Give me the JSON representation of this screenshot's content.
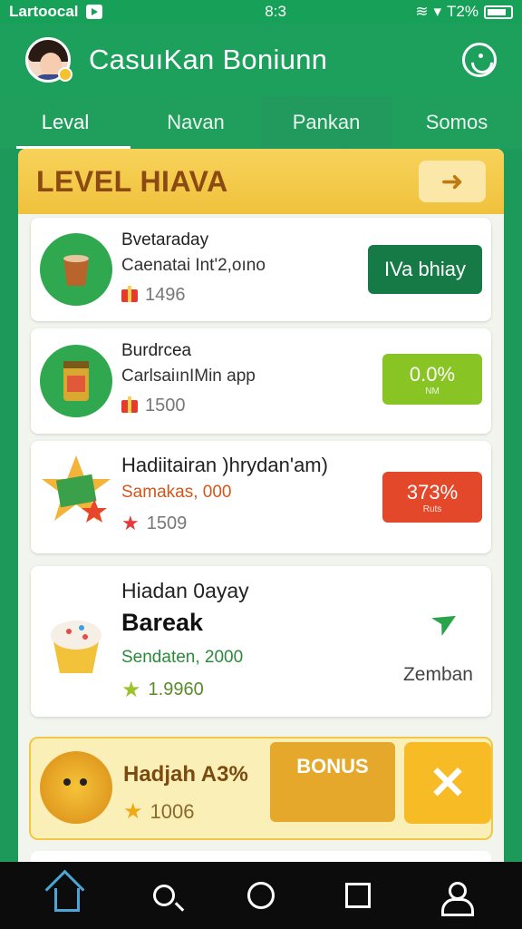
{
  "status_bar": {
    "carrier": "Lartoocal",
    "time": "8:3",
    "battery": "T2%"
  },
  "header": {
    "title": "CasuıKan Boniunn"
  },
  "tabs": [
    {
      "label": "Leval"
    },
    {
      "label": "Navan"
    },
    {
      "label": "Pankan"
    },
    {
      "label": "Somos"
    }
  ],
  "level_banner": {
    "title": "LEVEL HIAVA",
    "arrow": "➜"
  },
  "cards": [
    {
      "title": "Bvetaraday",
      "subtitle": "Caenatai Int'2,oıno",
      "stat": "1496",
      "action_main": "IVa bhiay",
      "action_small": ""
    },
    {
      "title": "Burdrcea",
      "subtitle": "CarlsaiınIMin app",
      "stat": "1500",
      "action_main": "0.0%",
      "action_small": "NM"
    },
    {
      "title": "Hadiitairan )hrydan'am)",
      "subtitle": "Samakas, 000",
      "stat": "1509",
      "action_main": "373%",
      "action_small": "Ruts"
    },
    {
      "title": "Hiadan 0ayay",
      "big": "Bareak",
      "subtitle": "Sendaten, 2000",
      "stat": "1.9960",
      "side_label": "Zemban"
    }
  ],
  "bonus": {
    "title": "Hadjah A3%",
    "stat": "1006",
    "button_label": "BONUS",
    "close_label": "✕"
  },
  "colors": {
    "primary_green": "#1da05c",
    "banner_yellow": "#f7d25a",
    "dark_green_button": "#157a45",
    "lime_button": "#88c424",
    "orange_button": "#e4482a",
    "bonus_gold": "#e6a82a"
  },
  "icons": [
    "gear-face-icon",
    "arrow-right-icon",
    "gift-icon",
    "star-icon",
    "send-arrow-icon",
    "home-icon",
    "search-icon",
    "circle-icon",
    "square-icon",
    "user-icon"
  ]
}
